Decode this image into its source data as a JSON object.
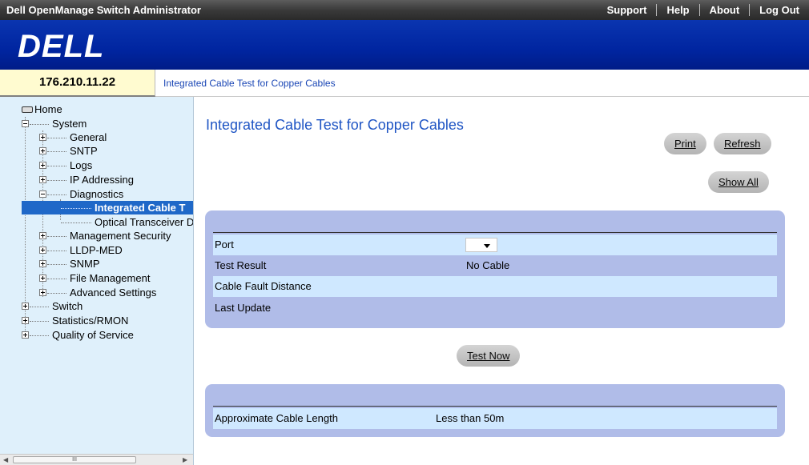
{
  "topbar": {
    "app_title": "Dell OpenManage Switch Administrator",
    "links": [
      "Support",
      "Help",
      "About",
      "Log Out"
    ]
  },
  "brand": {
    "logo": "DELL"
  },
  "ipbar": {
    "ip": "176.210.11.22",
    "breadcrumb": "Integrated Cable Test for Copper Cables"
  },
  "sidebar": {
    "home": "Home",
    "system": "System",
    "general": "General",
    "sntp": "SNTP",
    "logs": "Logs",
    "ip_addressing": "IP Addressing",
    "diagnostics": "Diagnostics",
    "integrated_cable": "Integrated Cable T",
    "optical": "Optical Transceiver D",
    "mgmt_security": "Management Security",
    "lldp_med": "LLDP-MED",
    "snmp": "SNMP",
    "file_mgmt": "File Management",
    "advanced": "Advanced Settings",
    "switch": "Switch",
    "stats": "Statistics/RMON",
    "qos": "Quality of Service",
    "scroll_grip": "III"
  },
  "main": {
    "title": "Integrated Cable Test for Copper Cables",
    "buttons": {
      "print": "Print",
      "refresh": "Refresh",
      "show_all": "Show All",
      "test_now": "Test Now"
    },
    "fields": {
      "port": {
        "label": "Port",
        "value": ""
      },
      "test_result": {
        "label": "Test Result",
        "value": "No Cable"
      },
      "fault_distance": {
        "label": "Cable Fault Distance",
        "value": ""
      },
      "last_update": {
        "label": "Last Update",
        "value": ""
      }
    },
    "length": {
      "label": "Approximate Cable Length",
      "value": "Less than 50m"
    }
  },
  "icons": [
    "hard-drive-icon",
    "expand-icon",
    "collapse-icon",
    "dropdown-caret-icon"
  ],
  "colors": {
    "banner": "#0025a0",
    "sidebar": "#dff0fb",
    "panel": "#b0bce8",
    "selected": "#1f68c8",
    "title": "#1f55c4"
  }
}
